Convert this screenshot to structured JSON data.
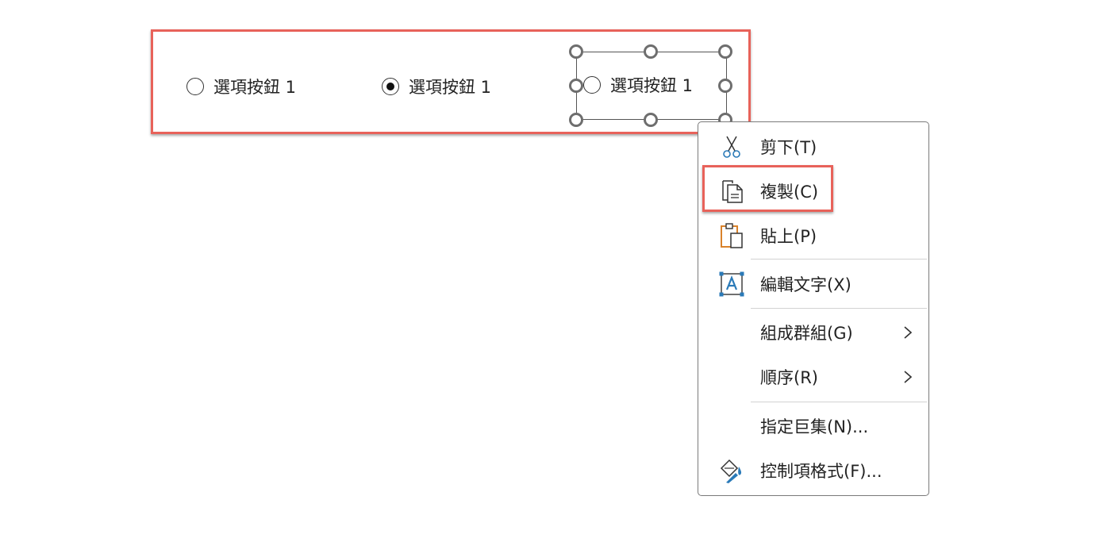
{
  "radios": [
    {
      "label": "選項按鈕 1",
      "checked": false
    },
    {
      "label": "選項按鈕 1",
      "checked": true
    },
    {
      "label": "選項按鈕 1",
      "checked": false
    }
  ],
  "context_menu": {
    "items": [
      {
        "label": "剪下(T)",
        "icon": "scissors-icon"
      },
      {
        "label": "複製(C)",
        "icon": "copy-icon"
      },
      {
        "label": "貼上(P)",
        "icon": "paste-icon"
      },
      {
        "label": "編輯文字(X)",
        "icon": "edit-text-icon"
      },
      {
        "label": "組成群組(G)",
        "icon": "",
        "submenu": true
      },
      {
        "label": "順序(R)",
        "icon": "",
        "submenu": true
      },
      {
        "label": "指定巨集(N)...",
        "icon": ""
      },
      {
        "label": "控制項格式(F)...",
        "icon": "format-control-icon"
      }
    ]
  },
  "colors": {
    "highlight": "#e8625a",
    "icon_blue": "#2a7ab8",
    "icon_orange": "#d9822b"
  }
}
